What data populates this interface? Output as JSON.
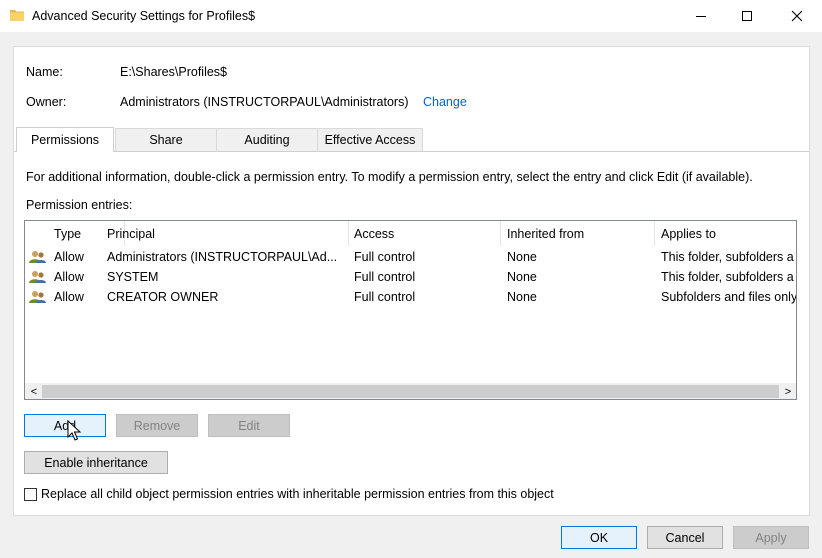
{
  "window": {
    "title": "Advanced Security Settings for Profiles$",
    "icon": "folder-icon"
  },
  "info": {
    "name_label": "Name:",
    "name_value": "E:\\Shares\\Profiles$",
    "owner_label": "Owner:",
    "owner_value": "Administrators (INSTRUCTORPAUL\\Administrators)",
    "change_link": "Change"
  },
  "tabs": [
    {
      "label": "Permissions",
      "active": true
    },
    {
      "label": "Share"
    },
    {
      "label": "Auditing"
    },
    {
      "label": "Effective Access"
    }
  ],
  "permissions": {
    "info_text": "For additional information, double-click a permission entry. To modify a permission entry, select the entry and click Edit (if available).",
    "entries_label": "Permission entries:",
    "columns": [
      "Type",
      "Principal",
      "Access",
      "Inherited from",
      "Applies to"
    ],
    "rows": [
      [
        "Allow",
        "Administrators (INSTRUCTORPAUL\\Ad...",
        "Full control",
        "None",
        "This folder, subfolders a"
      ],
      [
        "Allow",
        "SYSTEM",
        "Full control",
        "None",
        "This folder, subfolders a"
      ],
      [
        "Allow",
        "CREATOR OWNER",
        "Full control",
        "None",
        "Subfolders and files only"
      ]
    ],
    "scroll_left": "<",
    "scroll_right": ">",
    "add_button": "Add",
    "remove_button": "Remove",
    "edit_button": "Edit",
    "inheritance_button": "Enable inheritance",
    "replace_checkbox_label": "Replace all child object permission entries with inheritable permission entries from this object"
  },
  "footer": {
    "ok": "OK",
    "cancel": "Cancel",
    "apply": "Apply"
  },
  "colors": {
    "link": "#0066cc",
    "focus_border": "#0078d7"
  }
}
